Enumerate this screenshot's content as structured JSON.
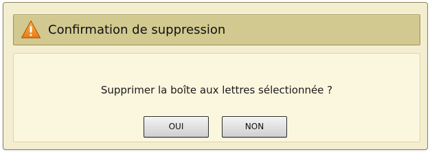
{
  "dialog": {
    "title": "Confirmation de suppression",
    "title_icon": "warning-triangle-icon",
    "message": "Supprimer la boîte aux lettres sélectionnée ?",
    "buttons": {
      "yes_label": "OUI",
      "no_label": "NON"
    }
  },
  "colors": {
    "header_bg": "#d2c990",
    "dialog_bg": "#f4eed1",
    "panel_bg": "#fbf6de",
    "icon_orange": "#f0922a"
  }
}
